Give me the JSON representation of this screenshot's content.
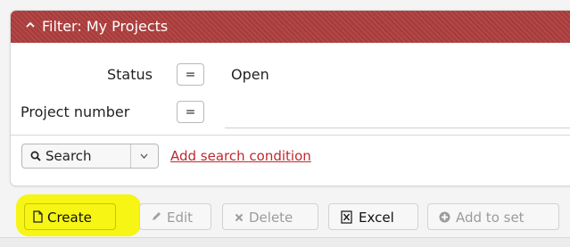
{
  "filter": {
    "title": "Filter: My Projects",
    "rows": [
      {
        "label": "Status",
        "operator": "=",
        "value": "Open"
      },
      {
        "label": "Project number",
        "operator": "=",
        "value": ""
      }
    ],
    "search_button": {
      "label": "Search"
    },
    "add_condition_link": "Add search condition"
  },
  "toolbar": {
    "buttons": [
      {
        "label": "Create",
        "enabled": true
      },
      {
        "label": "Edit",
        "enabled": false
      },
      {
        "label": "Delete",
        "enabled": false
      },
      {
        "label": "Excel",
        "enabled": true
      },
      {
        "label": "Add to set",
        "enabled": false
      }
    ]
  },
  "colors": {
    "header": "#a93a3a",
    "link": "#c0282d",
    "highlight": "#f6f400"
  }
}
